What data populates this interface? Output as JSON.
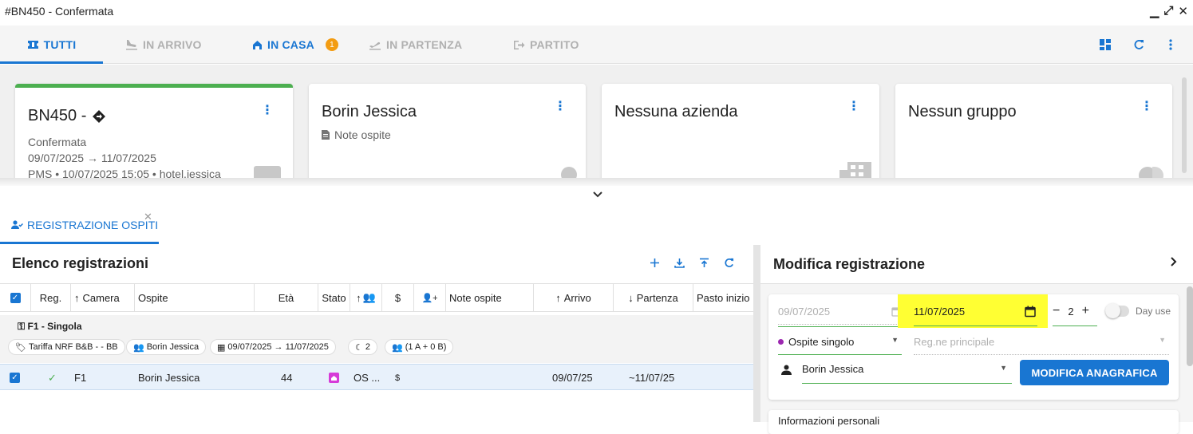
{
  "window": {
    "title": "#BN450 - Confermata",
    "min": "▁",
    "max": "⤢",
    "close": "✕"
  },
  "tabs": [
    {
      "label": "TUTTI",
      "icon": "ticket-icon"
    },
    {
      "label": "IN ARRIVO",
      "icon": "plane-landing-icon"
    },
    {
      "label": "IN CASA",
      "icon": "house-icon",
      "badge": "1"
    },
    {
      "label": "IN PARTENZA",
      "icon": "plane-takeoff-icon"
    },
    {
      "label": "PARTITO",
      "icon": "exit-icon"
    }
  ],
  "cards": {
    "booking": {
      "title": "BN450 -",
      "status": "Confermata",
      "dates": "09/07/2025 → 11/07/2025",
      "meta": "PMS • 10/07/2025 15:05 • hotel.jessica"
    },
    "guest": {
      "title": "Borin Jessica",
      "note": "Note ospite"
    },
    "company": {
      "title": "Nessuna azienda"
    },
    "group": {
      "title": "Nessun gruppo"
    }
  },
  "registration_tab": {
    "label": "REGISTRAZIONE OSPITI"
  },
  "list": {
    "title": "Elenco registrazioni",
    "columns": [
      "Reg.",
      "Camera",
      "Ospite",
      "Età",
      "Stato",
      "",
      "$",
      "",
      "Note ospite",
      "Arrivo",
      "Partenza",
      "Pasto inizio"
    ],
    "group": {
      "title": "F1 - Singola",
      "chips": [
        "Tariffa NRF B&B - - BB",
        "Borin Jessica",
        "09/07/2025 → 11/07/2025",
        "2",
        "(1 A + 0 B)"
      ]
    },
    "row": {
      "check": "✓",
      "camera": "F1",
      "ospite": "Borin Jessica",
      "eta": "44",
      "stato": "OS ...",
      "dollar": "$",
      "arrivo": "09/07/25",
      "partenza": "~11/07/25"
    }
  },
  "edit": {
    "title": "Modifica registrazione",
    "arrival_date": "09/07/2025",
    "departure_date": "11/07/2025",
    "nights": "2",
    "day_use_label": "Day use",
    "guest_type": "Ospite singolo",
    "main_reg_placeholder": "Reg.ne principale",
    "guest_name": "Borin Jessica",
    "button_label": "MODIFICA ANAGRAFICA",
    "info_section": "Informazioni personali"
  },
  "colors": {
    "accent": "#1976d2",
    "highlight": "#ffff33",
    "badge": "#f39c12",
    "success": "#4caf50"
  }
}
